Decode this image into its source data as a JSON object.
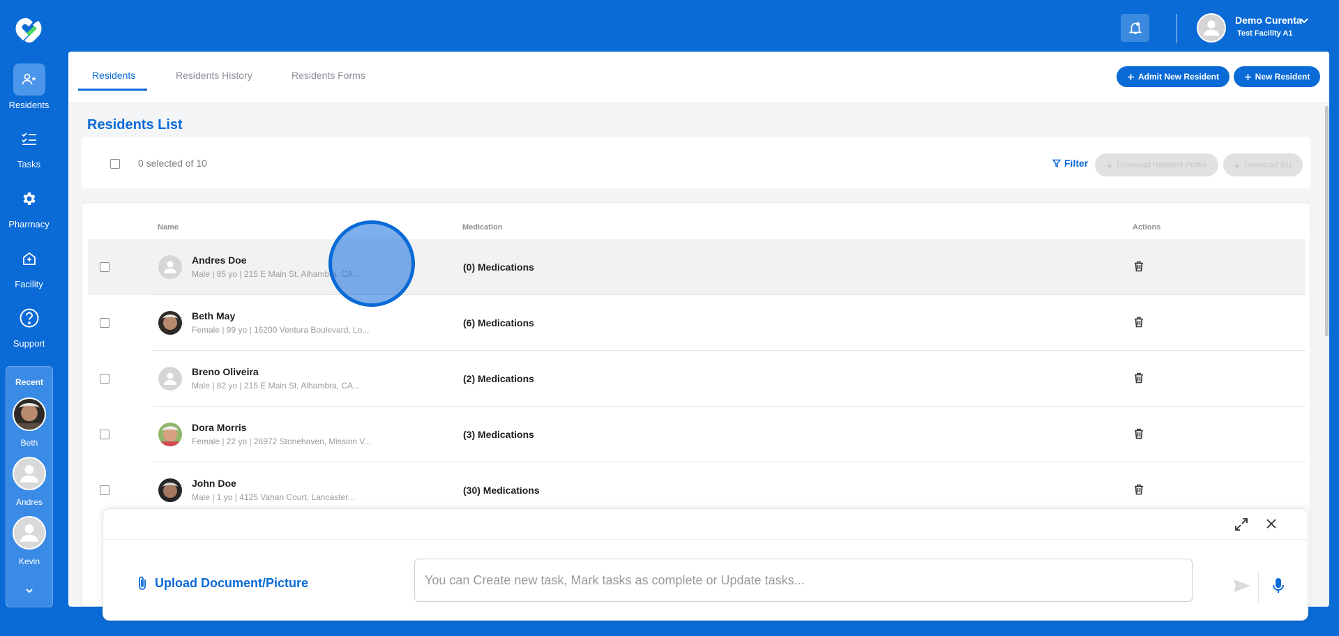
{
  "sidebar": {
    "items": [
      {
        "label": "Residents",
        "icon": "residents-icon"
      },
      {
        "label": "Tasks",
        "icon": "tasks-icon"
      },
      {
        "label": "Pharmacy",
        "icon": "gear-icon"
      },
      {
        "label": "Facility",
        "icon": "facility-icon"
      },
      {
        "label": "Support",
        "icon": "help-icon"
      }
    ],
    "recent": {
      "title": "Recent",
      "items": [
        {
          "name": "Beth"
        },
        {
          "name": "Andres"
        },
        {
          "name": "Kevin"
        }
      ]
    }
  },
  "header": {
    "user_name": "Demo Curenta",
    "facility": "Test Facility A1"
  },
  "tabs": [
    {
      "label": "Residents"
    },
    {
      "label": "Residents History"
    },
    {
      "label": "Residents Forms"
    }
  ],
  "actions": {
    "admit_label": "Admit New Resident",
    "new_label": "New Resident"
  },
  "list": {
    "title": "Residents List",
    "selection": "0 selected of 10",
    "filter_label": "Filter",
    "download_profile_label": "Download Resident Profile",
    "download_911_label": "Download 911"
  },
  "table": {
    "columns": {
      "name": "Name",
      "medication": "Medication",
      "actions": "Actions"
    },
    "rows": [
      {
        "name": "Andres Doe",
        "details": "Male | 85 yo | 215 E Main St, Alhambra, CA...",
        "medications": "(0) Medications"
      },
      {
        "name": "Beth May",
        "details": "Female | 99 yo | 16200 Ventura Boulevard, Lo...",
        "medications": "(6) Medications"
      },
      {
        "name": "Breno Oliveira",
        "details": "Male | 82 yo | 215 E Main St, Alhambra, CA...",
        "medications": "(2) Medications"
      },
      {
        "name": "Dora Morris",
        "details": "Female | 22 yo | 26972 Stonehaven, Mission V...",
        "medications": "(3) Medications"
      },
      {
        "name": "John Doe",
        "details": "Male | 1 yo | 4125 Vahan Court, Lancaster...",
        "medications": "(30) Medications"
      }
    ]
  },
  "assistant": {
    "upload_label": "Upload Document/Picture",
    "input_placeholder": "You can Create new task, Mark tasks as complete or Update tasks...",
    "input_value": ""
  },
  "colors": {
    "brand": "#0a6ad6",
    "background": "#f4f5f7"
  }
}
